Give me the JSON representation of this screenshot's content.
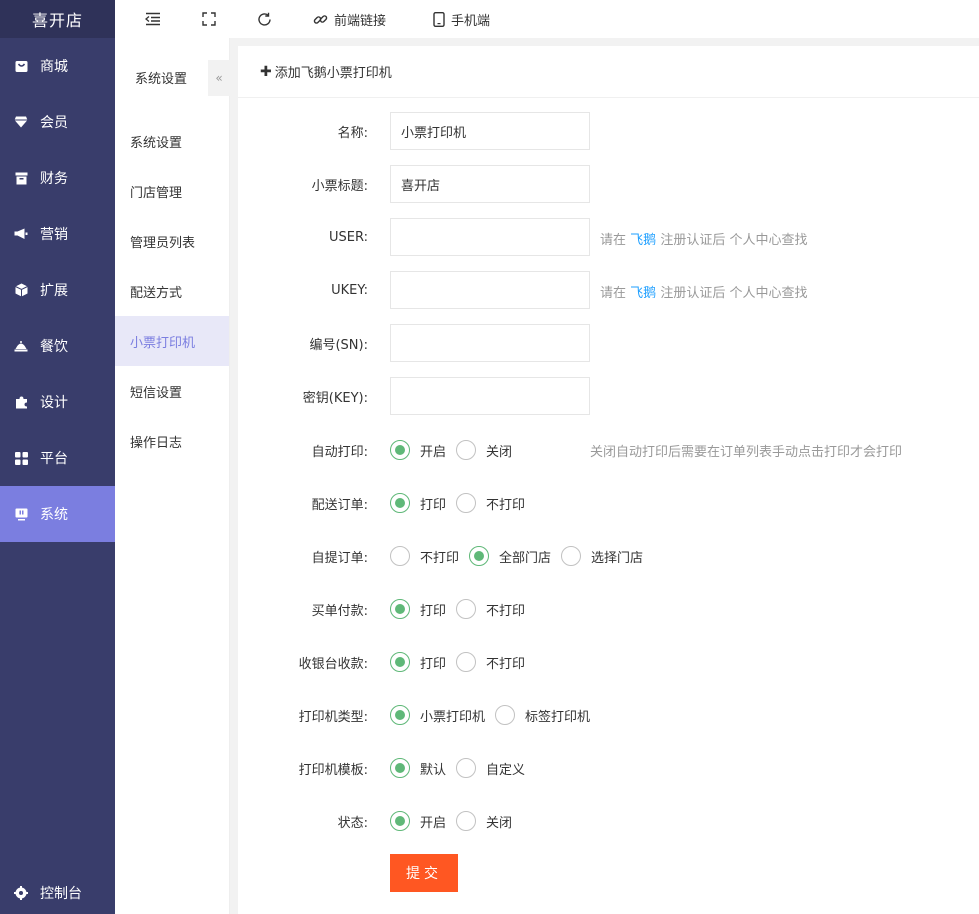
{
  "brand": "喜开店",
  "sidebar": {
    "items": [
      {
        "label": "商城",
        "icon": "shop-icon"
      },
      {
        "label": "会员",
        "icon": "diamond-icon"
      },
      {
        "label": "财务",
        "icon": "wallet-icon"
      },
      {
        "label": "营销",
        "icon": "megaphone-icon"
      },
      {
        "label": "扩展",
        "icon": "cube-icon"
      },
      {
        "label": "餐饮",
        "icon": "dish-cover-icon"
      },
      {
        "label": "设计",
        "icon": "puzzle-icon"
      },
      {
        "label": "平台",
        "icon": "grid-icon"
      },
      {
        "label": "系统",
        "icon": "monitor-icon",
        "active": true
      }
    ],
    "bottom": {
      "label": "控制台",
      "icon": "gear-icon"
    }
  },
  "topbar": {
    "menu_icon": "indent-icon",
    "fullscreen_icon": "fullscreen-icon",
    "refresh_icon": "refresh-icon",
    "frontend_link": "前端链接",
    "mobile": "手机端"
  },
  "subnav": {
    "title": "系统设置",
    "collapse": "«",
    "items": [
      "系统设置",
      "门店管理",
      "管理员列表",
      "配送方式",
      "小票打印机",
      "短信设置",
      "操作日志"
    ],
    "active_index": 4
  },
  "panel": {
    "title": "添加飞鹅小票打印机"
  },
  "form": {
    "name_label": "名称:",
    "name_value": "小票打印机",
    "ticket_title_label": "小票标题:",
    "ticket_title_value": "喜开店",
    "user_label": "USER:",
    "user_value": "",
    "ukey_label": "UKEY:",
    "ukey_value": "",
    "hint_prefix": "请在",
    "hint_link": "飞鹅",
    "hint_suffix": "注册认证后 个人中心查找",
    "sn_label": "编号(SN):",
    "sn_value": "",
    "key_label": "密钥(KEY):",
    "key_value": "",
    "auto_print": {
      "label": "自动打印:",
      "options": [
        "开启",
        "关闭"
      ],
      "selected": 0,
      "hint": "关闭自动打印后需要在订单列表手动点击打印才会打印"
    },
    "delivery_order": {
      "label": "配送订单:",
      "options": [
        "打印",
        "不打印"
      ],
      "selected": 0
    },
    "pickup_order": {
      "label": "自提订单:",
      "options": [
        "不打印",
        "全部门店",
        "选择门店"
      ],
      "selected": 1
    },
    "pay_order": {
      "label": "买单付款:",
      "options": [
        "打印",
        "不打印"
      ],
      "selected": 0
    },
    "cashier": {
      "label": "收银台收款:",
      "options": [
        "打印",
        "不打印"
      ],
      "selected": 0
    },
    "printer_type": {
      "label": "打印机类型:",
      "options": [
        "小票打印机",
        "标签打印机"
      ],
      "selected": 0
    },
    "printer_template": {
      "label": "打印机模板:",
      "options": [
        "默认",
        "自定义"
      ],
      "selected": 0
    },
    "status": {
      "label": "状态:",
      "options": [
        "开启",
        "关闭"
      ],
      "selected": 0
    },
    "submit": "提交"
  },
  "colors": {
    "sidebar_bg": "#393D6B",
    "sidebar_active": "#7B7EE0",
    "radio_checked": "#5FB878",
    "link": "#1E9FFF",
    "submit_bg": "#FF5722"
  }
}
